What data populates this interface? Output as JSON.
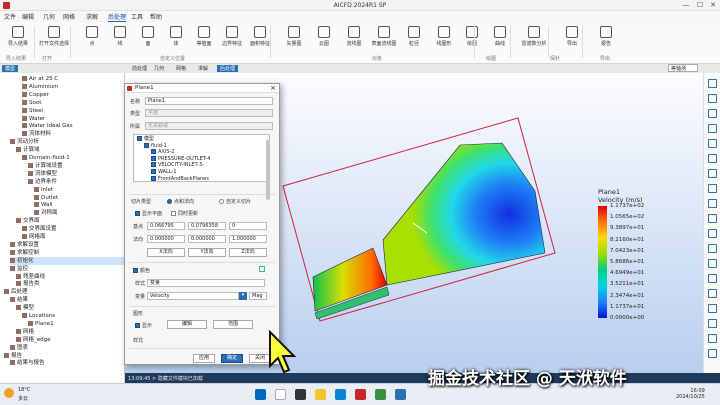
{
  "window": {
    "title": "AICFD 2024R1 SP",
    "minimize": "—",
    "maximize": "☐",
    "close": "✕"
  },
  "menu": [
    "文件",
    "编辑",
    "几何",
    "网格",
    "求解",
    "后处理",
    "工具",
    "帮助"
  ],
  "menu_active": "后处理",
  "ribbon": {
    "buttons": [
      "导入结果",
      "打开文件选择",
      "点",
      "线",
      "面",
      "体",
      "等值面",
      "边界特征",
      "面积特征",
      "矢量图",
      "云图",
      "流线图",
      "表面流线图",
      "粒径",
      "线图形",
      "绘图",
      "曲线",
      "雷诺数分析",
      "导出",
      "报告"
    ],
    "groups": [
      "导入结果",
      "打开",
      "自定义位置",
      "对象",
      "绘图",
      "探针",
      "导出"
    ]
  },
  "left_panel": {
    "tab": "模型",
    "items": [
      {
        "label": "Air at 25 C",
        "indent": 3
      },
      {
        "label": "Aluminium",
        "indent": 3
      },
      {
        "label": "Copper",
        "indent": 3
      },
      {
        "label": "Soot",
        "indent": 3
      },
      {
        "label": "Steel",
        "indent": 3
      },
      {
        "label": "Water",
        "indent": 3
      },
      {
        "label": "Water Ideal Gas",
        "indent": 3
      },
      {
        "label": "流体材料",
        "indent": 3
      },
      {
        "label": "流动分析",
        "indent": 1
      },
      {
        "label": "计算域",
        "indent": 2
      },
      {
        "label": "Domain-fluid-1",
        "indent": 3
      },
      {
        "label": "计算域设置",
        "indent": 4
      },
      {
        "label": "流体模型",
        "indent": 4
      },
      {
        "label": "边界条件",
        "indent": 4
      },
      {
        "label": "inlet",
        "indent": 5
      },
      {
        "label": "Outlet",
        "indent": 5
      },
      {
        "label": "Wall",
        "indent": 5
      },
      {
        "label": "对称面",
        "indent": 5
      },
      {
        "label": "交界面",
        "indent": 2
      },
      {
        "label": "交界面设置",
        "indent": 3
      },
      {
        "label": "网格面",
        "indent": 3
      },
      {
        "label": "求解设置",
        "indent": 1
      },
      {
        "label": "求解控制",
        "indent": 1
      },
      {
        "label": "初始化",
        "indent": 1,
        "selected": true
      },
      {
        "label": "监控",
        "indent": 1
      },
      {
        "label": "残差曲线",
        "indent": 2
      },
      {
        "label": "报告类",
        "indent": 2
      },
      {
        "label": "后处理",
        "indent": 0
      },
      {
        "label": "结果",
        "indent": 1
      },
      {
        "label": "模型",
        "indent": 2
      },
      {
        "label": "Locations",
        "indent": 3
      },
      {
        "label": "Plane1",
        "indent": 4
      },
      {
        "label": "网格",
        "indent": 2
      },
      {
        "label": "网格_edge",
        "indent": 2
      },
      {
        "label": "图表",
        "indent": 1
      },
      {
        "label": "报告",
        "indent": 0
      },
      {
        "label": "结果与报告",
        "indent": 1
      }
    ]
  },
  "view_tabs": [
    "前处理",
    "几何",
    "网格",
    "求解",
    "后处理"
  ],
  "view_tab_active": "后处理",
  "zoom_select": "等轴测",
  "dialog": {
    "title": "Plane1",
    "name_label": "名称",
    "name_value": "Plane1",
    "kind_label": "类型",
    "kind_value": "平面",
    "location_label": "所属",
    "location_value": "无关联域",
    "tree_items": [
      {
        "label": "模型",
        "indent": 0,
        "checked": true
      },
      {
        "label": "fluid-1",
        "indent": 1,
        "checked": true
      },
      {
        "label": "AXIS-2",
        "indent": 2,
        "checked": true
      },
      {
        "label": "PRESSURE-OUTLET-4",
        "indent": 2,
        "checked": true
      },
      {
        "label": "VELOCITY-INLET-3-",
        "indent": 2,
        "checked": true
      },
      {
        "label": "WALL-1",
        "indent": 2,
        "checked": true
      },
      {
        "label": "FrontAndBackPlanes",
        "indent": 2,
        "checked": true
      }
    ],
    "slice_label": "切片类型",
    "slice_opt1": "点和法向",
    "slice_opt2": "自定义切片",
    "show_plane_label": "显示平面",
    "sync_update_label": "同时更新",
    "point_label": "基点",
    "point_values": [
      "0.066795",
      "0.0796358",
      "0"
    ],
    "normal_label": "法向",
    "normal_values": [
      "0.000000",
      "0.000000",
      "1.000000"
    ],
    "axis_buttons": [
      "X法向",
      "Y法向",
      "Z法向"
    ],
    "color_label": "颜色",
    "style_label": "样式",
    "style_value": "变量",
    "var_label": "变量",
    "var_value": "Velocity",
    "var_btn": "Mag",
    "shape_label": "图形",
    "display_label": "显示",
    "edit_btn": "编辑",
    "range_btn": "范围",
    "format_label": "样式",
    "apply_btn": "应用",
    "ok_btn": "确定",
    "cancel_btn": "关闭"
  },
  "legend": {
    "title": "Plane1",
    "variable": "Velocity (m/s)",
    "ticks": [
      "1.1737e+02",
      "1.0565e+02",
      "9.3897e+01",
      "8.2160e+01",
      "7.0423e+01",
      "5.8686e+01",
      "4.6949e+01",
      "3.5211e+01",
      "2.3474e+01",
      "1.1737e+01",
      "0.0000e+00"
    ]
  },
  "statusbar": "13:09:45 > 隐藏文件模块已加载",
  "taskbar": {
    "weather_temp": "18°C",
    "weather_desc": "多云",
    "time": "16:09",
    "date": "2024/10/25"
  },
  "watermark": "掘金技术社区 @ 天洑软件"
}
